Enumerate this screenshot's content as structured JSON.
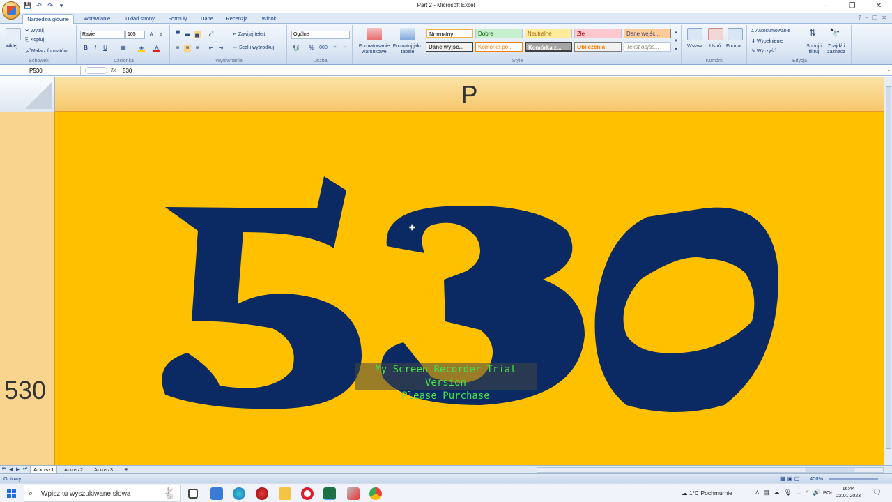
{
  "window": {
    "title": "Part 2 - Microsoft Excel",
    "controls": [
      "–",
      "❐",
      "✕"
    ]
  },
  "qat": [
    "💾",
    "↶",
    "↷",
    "▾"
  ],
  "tabs": [
    "Narzędzia główne",
    "Wstawianie",
    "Układ strony",
    "Formuły",
    "Dane",
    "Recenzja",
    "Widok"
  ],
  "ribbon": {
    "clipboard": {
      "paste": "Wklej",
      "cut": "Wytnij",
      "copy": "Kopiuj",
      "format_painter": "Malarz formatów",
      "label": "Schowek"
    },
    "font": {
      "name": "Ravie",
      "size": "105",
      "label": "Czcionka",
      "bold": "B",
      "italic": "I",
      "underline": "U"
    },
    "alignment": {
      "wrap": "Zawijaj tekst",
      "merge": "Scal i wyśrodkuj",
      "label": "Wyrównanie"
    },
    "number": {
      "format": "Ogólne",
      "label": "Liczba",
      "pct": "%",
      "thousands": "000"
    },
    "styles": {
      "conditional": "Formatowanie warunkowe",
      "as_table": "Formatuj jako tabelę",
      "cells": [
        "Normalny",
        "Dobre",
        "Neutralne",
        "Złe",
        "Dane wejśc...",
        "Dane wyjśc...",
        "Komórka po...",
        "Komórka z...",
        "Obliczenia",
        "Tekst objaś..."
      ],
      "label": "Style"
    },
    "cells": {
      "insert": "Wstaw",
      "delete": "Usuń",
      "format": "Format",
      "label": "Komórki"
    },
    "editing": {
      "autosum": "Autosumowanie",
      "fill": "Wypełnienie",
      "clear": "Wyczyść",
      "sort": "Sortuj i filtruj",
      "find": "Znajdź i zaznacz",
      "label": "Edycja"
    }
  },
  "formula_bar": {
    "name_box": "P530",
    "fx": "fx",
    "formula": "530"
  },
  "sheet": {
    "column": "P",
    "row": "530",
    "cell_value": "530",
    "cell_color": "#ffc000",
    "text_color": "#0b2a63"
  },
  "watermark": {
    "line1": "My Screen Recorder Trial Version",
    "line2": "Please Purchase"
  },
  "sheet_tabs": [
    "Arkusz1",
    "Arkusz2",
    "Arkusz3"
  ],
  "status": {
    "ready": "Gotowy",
    "zoom": "400%"
  },
  "taskbar": {
    "search_placeholder": "Wpisz tu wyszukiwane słowa",
    "weather": "1°C  Pochmurnie",
    "lang": "POL",
    "time": "16:44",
    "date": "22.01.2023"
  }
}
